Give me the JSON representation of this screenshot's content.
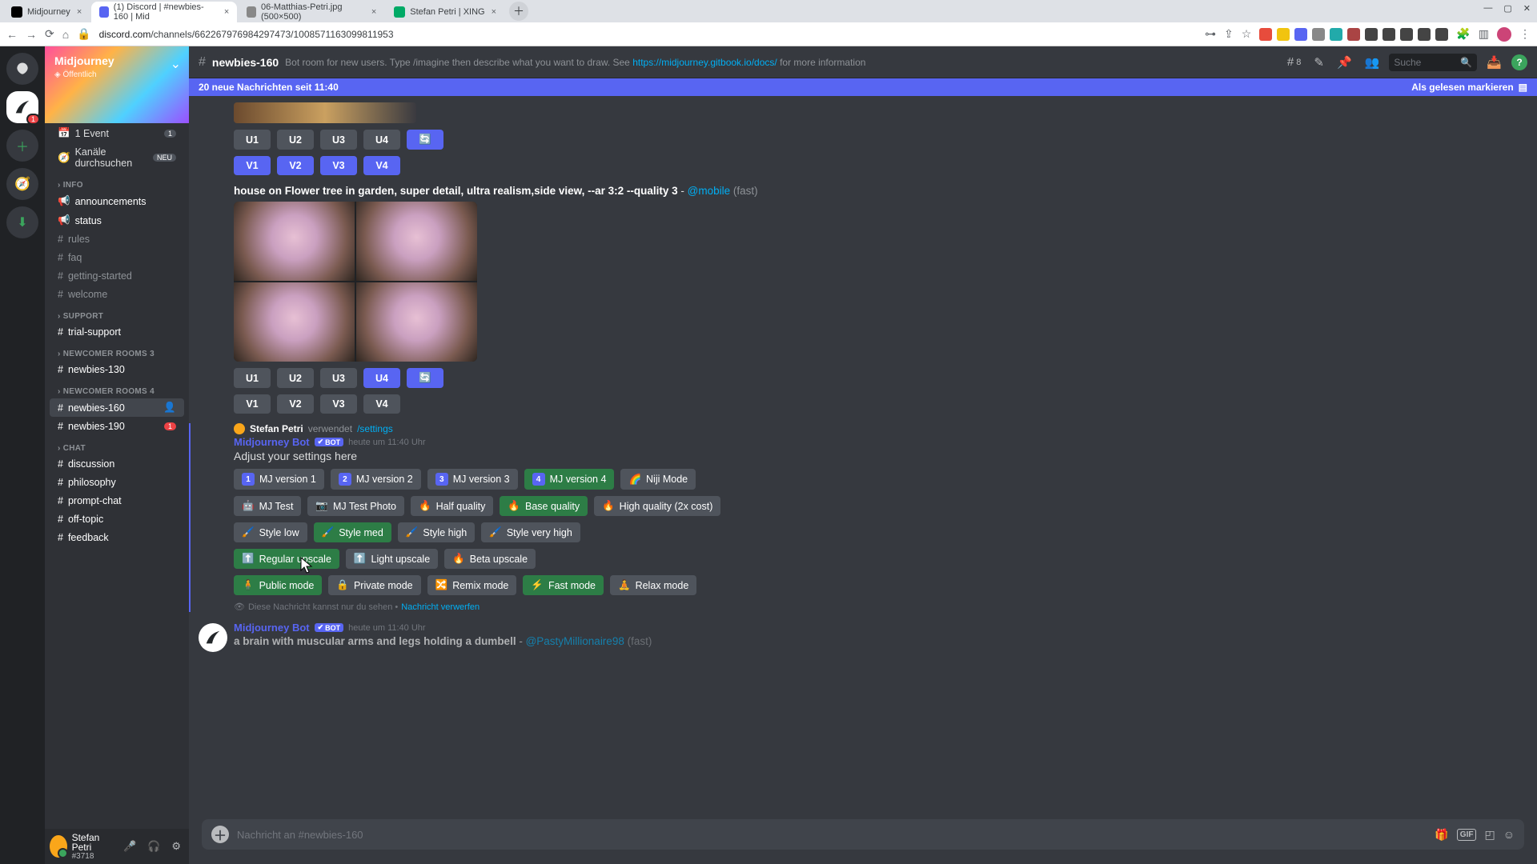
{
  "browser": {
    "tabs": [
      {
        "label": "Midjourney",
        "fav": "#000"
      },
      {
        "label": "(1) Discord | #newbies-160 | Mid",
        "fav": "#5865f2",
        "active": true
      },
      {
        "label": "06-Matthias-Petri.jpg (500×500)",
        "fav": "#888"
      },
      {
        "label": "Stefan Petri | XING",
        "fav": "#0a6"
      }
    ],
    "url_domain": "discord.com",
    "url_path": "/channels/662267976984297473/1008571163099811953",
    "window_controls": [
      "—",
      "▢",
      "✕"
    ],
    "ext_colors": [
      "#e74c3c",
      "#f1c40f",
      "#5865f2",
      "#888",
      "#2aa",
      "#a44",
      "#444",
      "#444",
      "#444",
      "#444",
      "#444"
    ]
  },
  "server": {
    "name": "Midjourney",
    "public_label": "Öffentlich",
    "event_row": {
      "icon": "📅",
      "label": "1 Event",
      "count": "1"
    },
    "browse_row": {
      "label": "Kanäle durchsuchen",
      "badge": "NEU"
    },
    "categories": [
      {
        "name": "INFO",
        "channels": [
          {
            "name": "announcements",
            "icon": "📢",
            "unread": true
          },
          {
            "name": "status",
            "icon": "📢",
            "unread": true
          },
          {
            "name": "rules",
            "icon": "#"
          },
          {
            "name": "faq",
            "icon": "#"
          },
          {
            "name": "getting-started",
            "icon": "#"
          },
          {
            "name": "welcome",
            "icon": "#"
          }
        ]
      },
      {
        "name": "SUPPORT",
        "channels": [
          {
            "name": "trial-support",
            "icon": "#",
            "unread": true
          }
        ]
      },
      {
        "name": "NEWCOMER ROOMS 3",
        "channels": [
          {
            "name": "newbies-130",
            "icon": "#",
            "unread": true
          }
        ]
      },
      {
        "name": "NEWCOMER ROOMS 4",
        "channels": [
          {
            "name": "newbies-160",
            "icon": "#",
            "selected": true,
            "person": true
          },
          {
            "name": "newbies-190",
            "icon": "#",
            "unread": true,
            "badge": "1"
          }
        ]
      },
      {
        "name": "CHAT",
        "channels": [
          {
            "name": "discussion",
            "icon": "#",
            "unread": true
          },
          {
            "name": "philosophy",
            "icon": "#",
            "unread": true
          },
          {
            "name": "prompt-chat",
            "icon": "#",
            "unread": true
          },
          {
            "name": "off-topic",
            "icon": "#",
            "unread": true
          },
          {
            "name": "feedback",
            "icon": "#",
            "unread": true
          }
        ]
      }
    ]
  },
  "user": {
    "name": "Stefan Petri",
    "tag": "#3718"
  },
  "topbar": {
    "channel": "newbies-160",
    "desc_pre": "Bot room for new users. Type /imagine then describe what you want to draw. See ",
    "desc_link": "https://midjourney.gitbook.io/docs/",
    "desc_post": " for more information",
    "thread_count": "8",
    "search_placeholder": "Suche"
  },
  "newmsg": {
    "text": "20 neue Nachrichten seit 11:40",
    "mark": "Als gelesen markieren"
  },
  "msg1": {
    "u": [
      "U1",
      "U2",
      "U3",
      "U4"
    ],
    "v": [
      "V1",
      "V2",
      "V3",
      "V4"
    ],
    "u4_active": false
  },
  "msg2": {
    "prompt_bold": "house on Flower tree in garden, super detail, ultra realism,side view, --ar 3:2 --quality 3",
    "sep": " - ",
    "mention": "@mobile",
    "fast": " (fast)",
    "u": [
      "U1",
      "U2",
      "U3",
      "U4"
    ],
    "v": [
      "V1",
      "V2",
      "V3",
      "V4"
    ]
  },
  "settings": {
    "user": "Stefan Petri",
    "used": "verwendet",
    "cmd": "/settings",
    "bot": "Midjourney Bot",
    "bot_badge": "BOT",
    "ts": "heute um 11:40 Uhr",
    "adjust": "Adjust your settings here",
    "rows": [
      [
        {
          "emoji": "num",
          "num": "1",
          "label": "MJ version 1"
        },
        {
          "emoji": "num",
          "num": "2",
          "label": "MJ version 2"
        },
        {
          "emoji": "num",
          "num": "3",
          "label": "MJ version 3"
        },
        {
          "emoji": "num",
          "num": "4",
          "label": "MJ version 4",
          "green": true
        },
        {
          "emoji": "🌈",
          "label": "Niji Mode"
        }
      ],
      [
        {
          "emoji": "🤖",
          "label": "MJ Test"
        },
        {
          "emoji": "📷",
          "label": "MJ Test Photo"
        },
        {
          "emoji": "🔥",
          "label": "Half quality"
        },
        {
          "emoji": "🔥",
          "label": "Base quality",
          "green": true
        },
        {
          "emoji": "🔥",
          "label": "High quality (2x cost)"
        }
      ],
      [
        {
          "emoji": "🖌️",
          "label": "Style low"
        },
        {
          "emoji": "🖌️",
          "label": "Style med",
          "green": true
        },
        {
          "emoji": "🖌️",
          "label": "Style high"
        },
        {
          "emoji": "🖌️",
          "label": "Style very high"
        }
      ],
      [
        {
          "emoji": "⬆️",
          "label": "Regular upscale",
          "green": true
        },
        {
          "emoji": "⬆️",
          "label": "Light upscale"
        },
        {
          "emoji": "🔥",
          "label": "Beta upscale"
        }
      ],
      [
        {
          "emoji": "🧍",
          "label": "Public mode",
          "green": true
        },
        {
          "emoji": "🔒",
          "label": "Private mode"
        },
        {
          "emoji": "🔀",
          "label": "Remix mode"
        },
        {
          "emoji": "⚡",
          "label": "Fast mode",
          "green": true
        },
        {
          "emoji": "🧘",
          "label": "Relax mode"
        }
      ]
    ],
    "eye_text": "Diese Nachricht kannst nur du sehen • ",
    "eye_link": "Nachricht verwerfen"
  },
  "msg3": {
    "bot": "Midjourney Bot",
    "bot_badge": "BOT",
    "ts": "heute um 11:40 Uhr",
    "prompt_bold": "a brain with muscular arms and legs holding a dumbell",
    "sep": " - ",
    "mention": "@PastyMillionaire98",
    "fast": " (fast)"
  },
  "composer": {
    "placeholder": "Nachricht an #newbies-160"
  }
}
